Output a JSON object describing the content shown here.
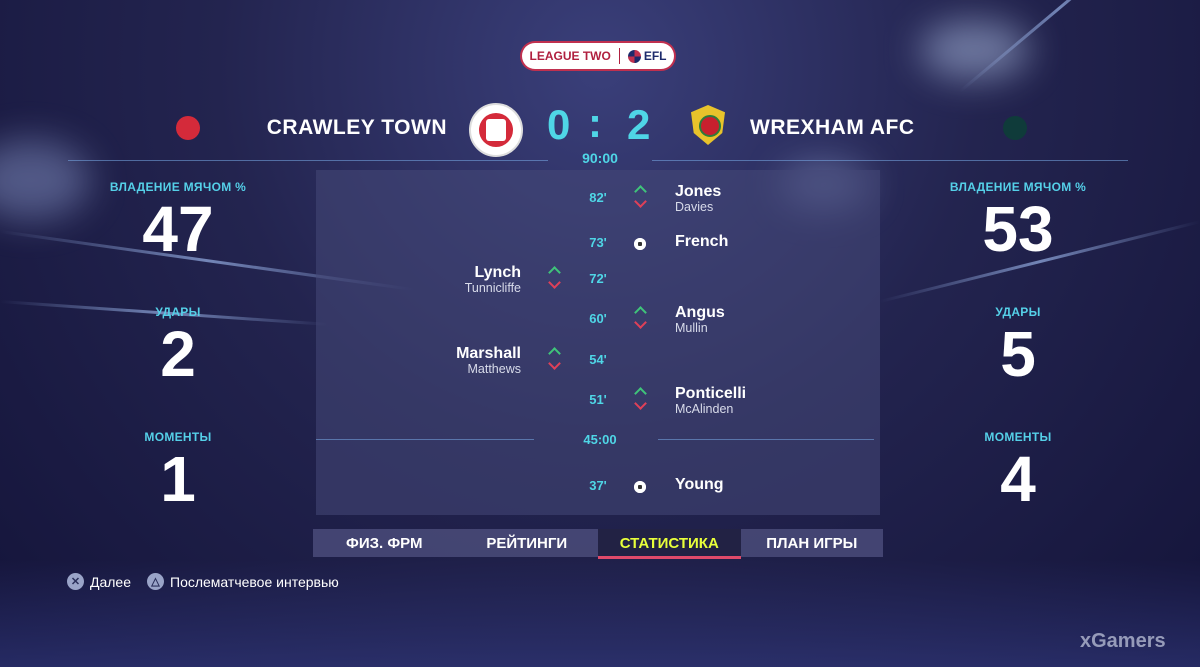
{
  "league": {
    "name": "LEAGUE TWO",
    "badge": "EFL"
  },
  "home": {
    "name": "CRAWLEY TOWN",
    "score": "0",
    "color": "#d42a3a",
    "stats": [
      {
        "label": "ВЛАДЕНИЕ МЯЧОМ %",
        "value": "47"
      },
      {
        "label": "УДАРЫ",
        "value": "2"
      },
      {
        "label": "МОМЕНТЫ",
        "value": "1"
      }
    ]
  },
  "away": {
    "name": "WREXHAM AFC",
    "score": "2",
    "color": "#0f3b3a",
    "stats": [
      {
        "label": "ВЛАДЕНИЕ МЯЧОМ %",
        "value": "53"
      },
      {
        "label": "УДАРЫ",
        "value": "5"
      },
      {
        "label": "МОМЕНТЫ",
        "value": "4"
      }
    ]
  },
  "score_separator": ":",
  "match_time": "90:00",
  "half_time": "45:00",
  "events": [
    {
      "minute": "82'",
      "side": "away",
      "type": "substitution",
      "player_in": "Jones",
      "player_out": "Davies"
    },
    {
      "minute": "73'",
      "side": "away",
      "type": "goal",
      "player": "French"
    },
    {
      "minute": "72'",
      "side": "home",
      "type": "substitution",
      "player_in": "Lynch",
      "player_out": "Tunnicliffe"
    },
    {
      "minute": "60'",
      "side": "away",
      "type": "substitution",
      "player_in": "Angus",
      "player_out": "Mullin"
    },
    {
      "minute": "54'",
      "side": "home",
      "type": "substitution",
      "player_in": "Marshall",
      "player_out": "Matthews"
    },
    {
      "minute": "51'",
      "side": "away",
      "type": "substitution",
      "player_in": "Ponticelli",
      "player_out": "McAlinden"
    },
    {
      "minute": "37'",
      "side": "away",
      "type": "goal",
      "player": "Young"
    }
  ],
  "tabs": [
    {
      "label": "ФИЗ. ФРМ",
      "active": false
    },
    {
      "label": "РЕЙТИНГИ",
      "active": false
    },
    {
      "label": "СТАТИСТИКА",
      "active": true
    },
    {
      "label": "ПЛАН ИГРЫ",
      "active": false
    }
  ],
  "hints": [
    {
      "button": "cross-button-icon",
      "label": "Далее"
    },
    {
      "button": "triangle-button-icon",
      "label": "Послематчевое интервью"
    }
  ],
  "watermark": "xGamers",
  "colors": {
    "accent": "#4fd6e6",
    "active_tab_text": "#e8ff3a",
    "tab_underline": "#e04a6a"
  }
}
